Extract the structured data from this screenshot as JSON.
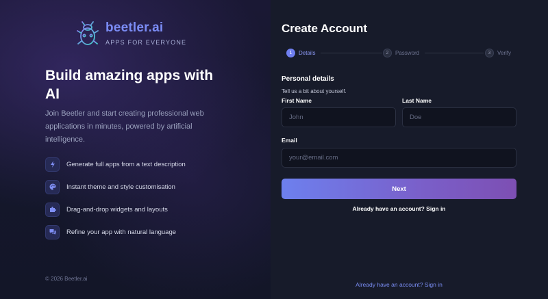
{
  "brand": {
    "name": "beetler.ai",
    "tagline": "APPS FOR EVERYONE",
    "logo_icon": "beetle-logo-icon"
  },
  "hero": {
    "headline": "Build amazing apps with AI",
    "description": "Join Beetler and start creating professional web applications in minutes, powered by artificial intelligence."
  },
  "features": [
    {
      "icon": "lightning-icon",
      "label": "Generate full apps from a text description"
    },
    {
      "icon": "palette-icon",
      "label": "Instant theme and style customisation"
    },
    {
      "icon": "puzzle-icon",
      "label": "Drag-and-drop widgets and layouts"
    },
    {
      "icon": "chat-icon",
      "label": "Refine your app with natural language"
    }
  ],
  "copyright": "© 2026 Beetler.ai",
  "form": {
    "title": "Create Account",
    "steps": [
      {
        "number": "1",
        "label": "Details",
        "active": true
      },
      {
        "number": "2",
        "label": "Password",
        "active": false
      },
      {
        "number": "3",
        "label": "Verify",
        "active": false
      }
    ],
    "section_title": "Personal details",
    "section_subtitle": "Tell us a bit about yourself.",
    "first_name": {
      "label": "First Name",
      "placeholder": "John",
      "value": ""
    },
    "last_name": {
      "label": "Last Name",
      "placeholder": "Doe",
      "value": ""
    },
    "email": {
      "label": "Email",
      "placeholder": "your@email.com",
      "value": ""
    },
    "next_label": "Next",
    "signin_prompt": "Already have an account? Sign in"
  },
  "footer_link": "Already have an account? Sign in",
  "colors": {
    "accent": "#6f7ff0",
    "brand": "#7b8cf5",
    "background": "#171b2a",
    "button_gradient_end": "#7d4fb3"
  }
}
